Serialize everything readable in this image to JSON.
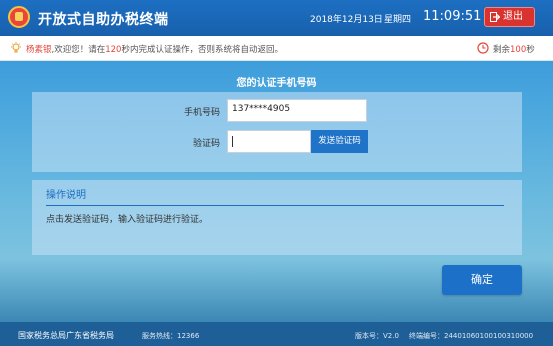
{
  "header": {
    "title": "开放式自助办税终端",
    "date": "2018年12月13日",
    "weekday": "星期四",
    "time": "11:09:51",
    "exit_label": "退出"
  },
  "notice": {
    "user_name": "杨素银",
    "greeting_prefix": ",欢迎您！请在",
    "seconds": "120",
    "greeting_suffix": "秒内完成认证操作，否则系统将自动返回。",
    "remaining_prefix": "剩余",
    "remaining_seconds": "100",
    "remaining_suffix": "秒"
  },
  "form": {
    "title": "您的认证手机号码",
    "phone_label": "手机号码",
    "phone_value": "137****4905",
    "code_label": "验证码",
    "code_value": "",
    "send_code_label": "发送验证码"
  },
  "instructions": {
    "header": "操作说明",
    "text": "点击发送验证码，输入验证码进行验证。"
  },
  "confirm_label": "确定",
  "footer": {
    "org": "国家税务总局广东省税务局",
    "hotline": "服务热线：12366",
    "version": "版本号：V2.0",
    "terminal": "终端编号：24401060100100310000"
  },
  "colors": {
    "header_bg": "#1d6fc2",
    "exit_bg": "#d9332f",
    "highlight": "#e4463a",
    "primary_button": "#1c70c8",
    "footer_bg": "#1f5f98"
  }
}
